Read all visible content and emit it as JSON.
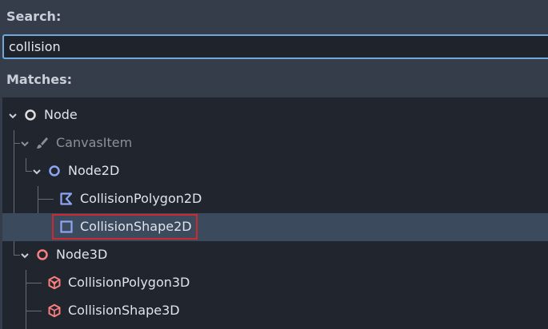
{
  "search": {
    "label": "Search:",
    "value": "collision"
  },
  "matches": {
    "label": "Matches:"
  },
  "tree": [
    {
      "label": "Node",
      "icon": "node-circle-icon",
      "state": "expanded"
    },
    {
      "label": "CanvasItem",
      "icon": "brush-icon",
      "state": "expanded",
      "disabled": true
    },
    {
      "label": "Node2D",
      "icon": "node2d-circle-icon",
      "state": "expanded"
    },
    {
      "label": "CollisionPolygon2D",
      "icon": "collision-polygon-2d-icon"
    },
    {
      "label": "CollisionShape2D",
      "icon": "collision-shape-2d-icon",
      "selected": true
    },
    {
      "label": "Node3D",
      "icon": "node3d-circle-icon",
      "state": "expanded"
    },
    {
      "label": "CollisionPolygon3D",
      "icon": "collision-polygon-3d-icon"
    },
    {
      "label": "CollisionShape3D",
      "icon": "collision-shape-3d-icon"
    }
  ],
  "colors": {
    "node_white": "#e0e0e0",
    "node2d_blue": "#8da5f3",
    "node3d_red": "#fc7f7f",
    "selection": "#3c4a5d",
    "highlight": "#cc2a30",
    "accent": "#6fa8dc"
  }
}
